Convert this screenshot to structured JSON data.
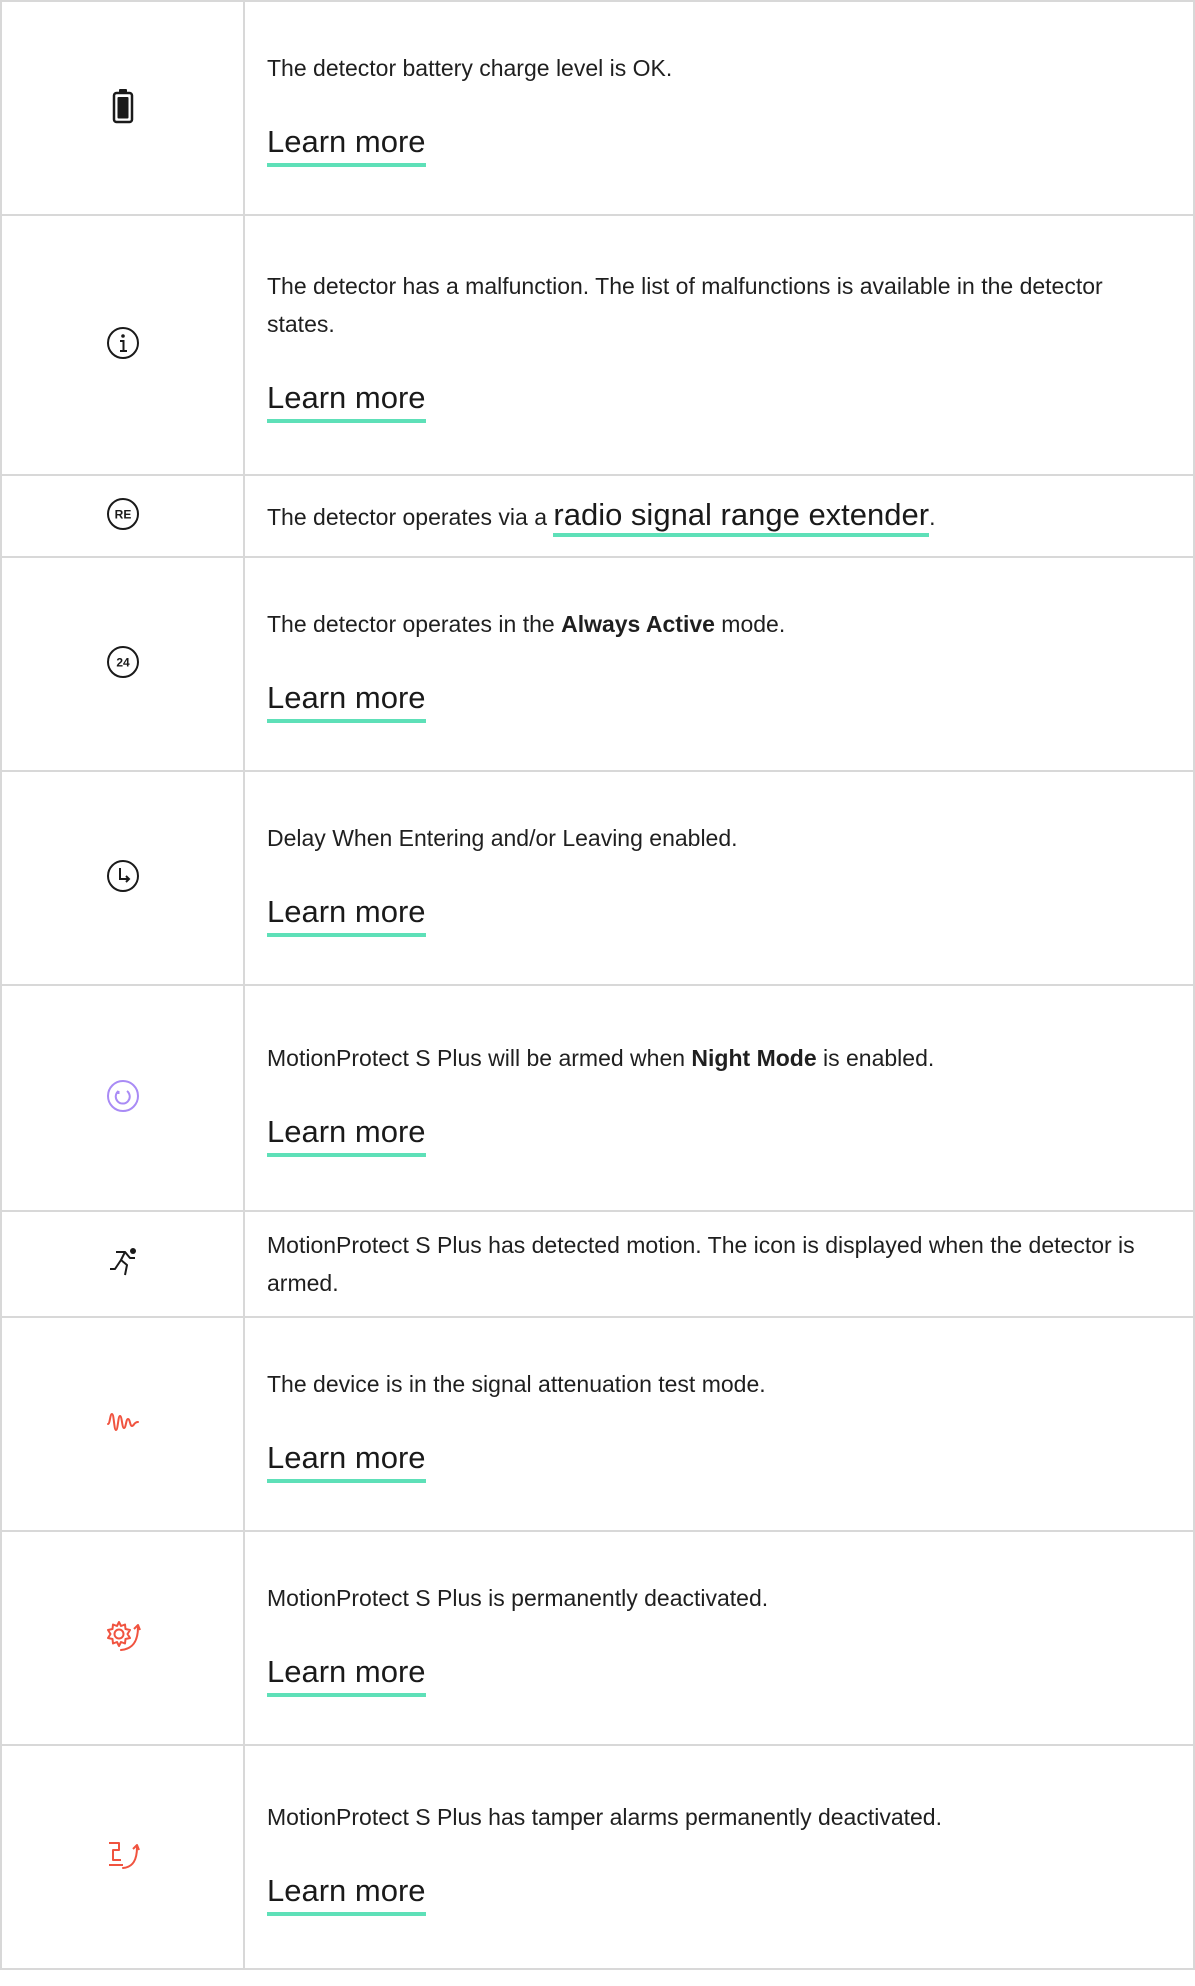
{
  "colors": {
    "link_underline": "#5ee0b8",
    "night_mode_icon": "#a98bf5",
    "warning_icon": "#f0533f",
    "border": "#d8d8d8"
  },
  "rows": [
    {
      "icon": "battery-icon",
      "text": "The detector battery charge level is OK.",
      "link": "Learn more"
    },
    {
      "icon": "info-icon",
      "text": "The detector has a malfunction. The list of malfunctions is available in the detector states.",
      "link": "Learn more"
    },
    {
      "icon": "range-extender-icon",
      "icon_label": "RE",
      "text_before": "The detector operates via a ",
      "inline_link": "radio signal range extender",
      "text_after": "."
    },
    {
      "icon": "always-active-icon",
      "icon_label": "24",
      "text_before": "The detector operates in the ",
      "bold": "Always Active",
      "text_after": " mode.",
      "link": "Learn more"
    },
    {
      "icon": "delay-clock-icon",
      "text": "Delay When Entering and/or Leaving enabled.",
      "link": "Learn more"
    },
    {
      "icon": "night-mode-icon",
      "text_before": "MotionProtect S Plus will be armed when ",
      "bold": "Night Mode",
      "text_after": " is enabled.",
      "link": "Learn more"
    },
    {
      "icon": "motion-detected-icon",
      "text": "MotionProtect S Plus has detected motion. The icon is displayed when the detector is armed."
    },
    {
      "icon": "signal-attenuation-icon",
      "text": "The device is in the signal attenuation test mode.",
      "link": "Learn more"
    },
    {
      "icon": "permanently-deactivated-icon",
      "text": "MotionProtect S Plus is permanently deactivated.",
      "link": "Learn more"
    },
    {
      "icon": "tamper-deactivated-icon",
      "text": "MotionProtect S Plus has tamper alarms permanently deactivated.",
      "link": "Learn more"
    }
  ]
}
